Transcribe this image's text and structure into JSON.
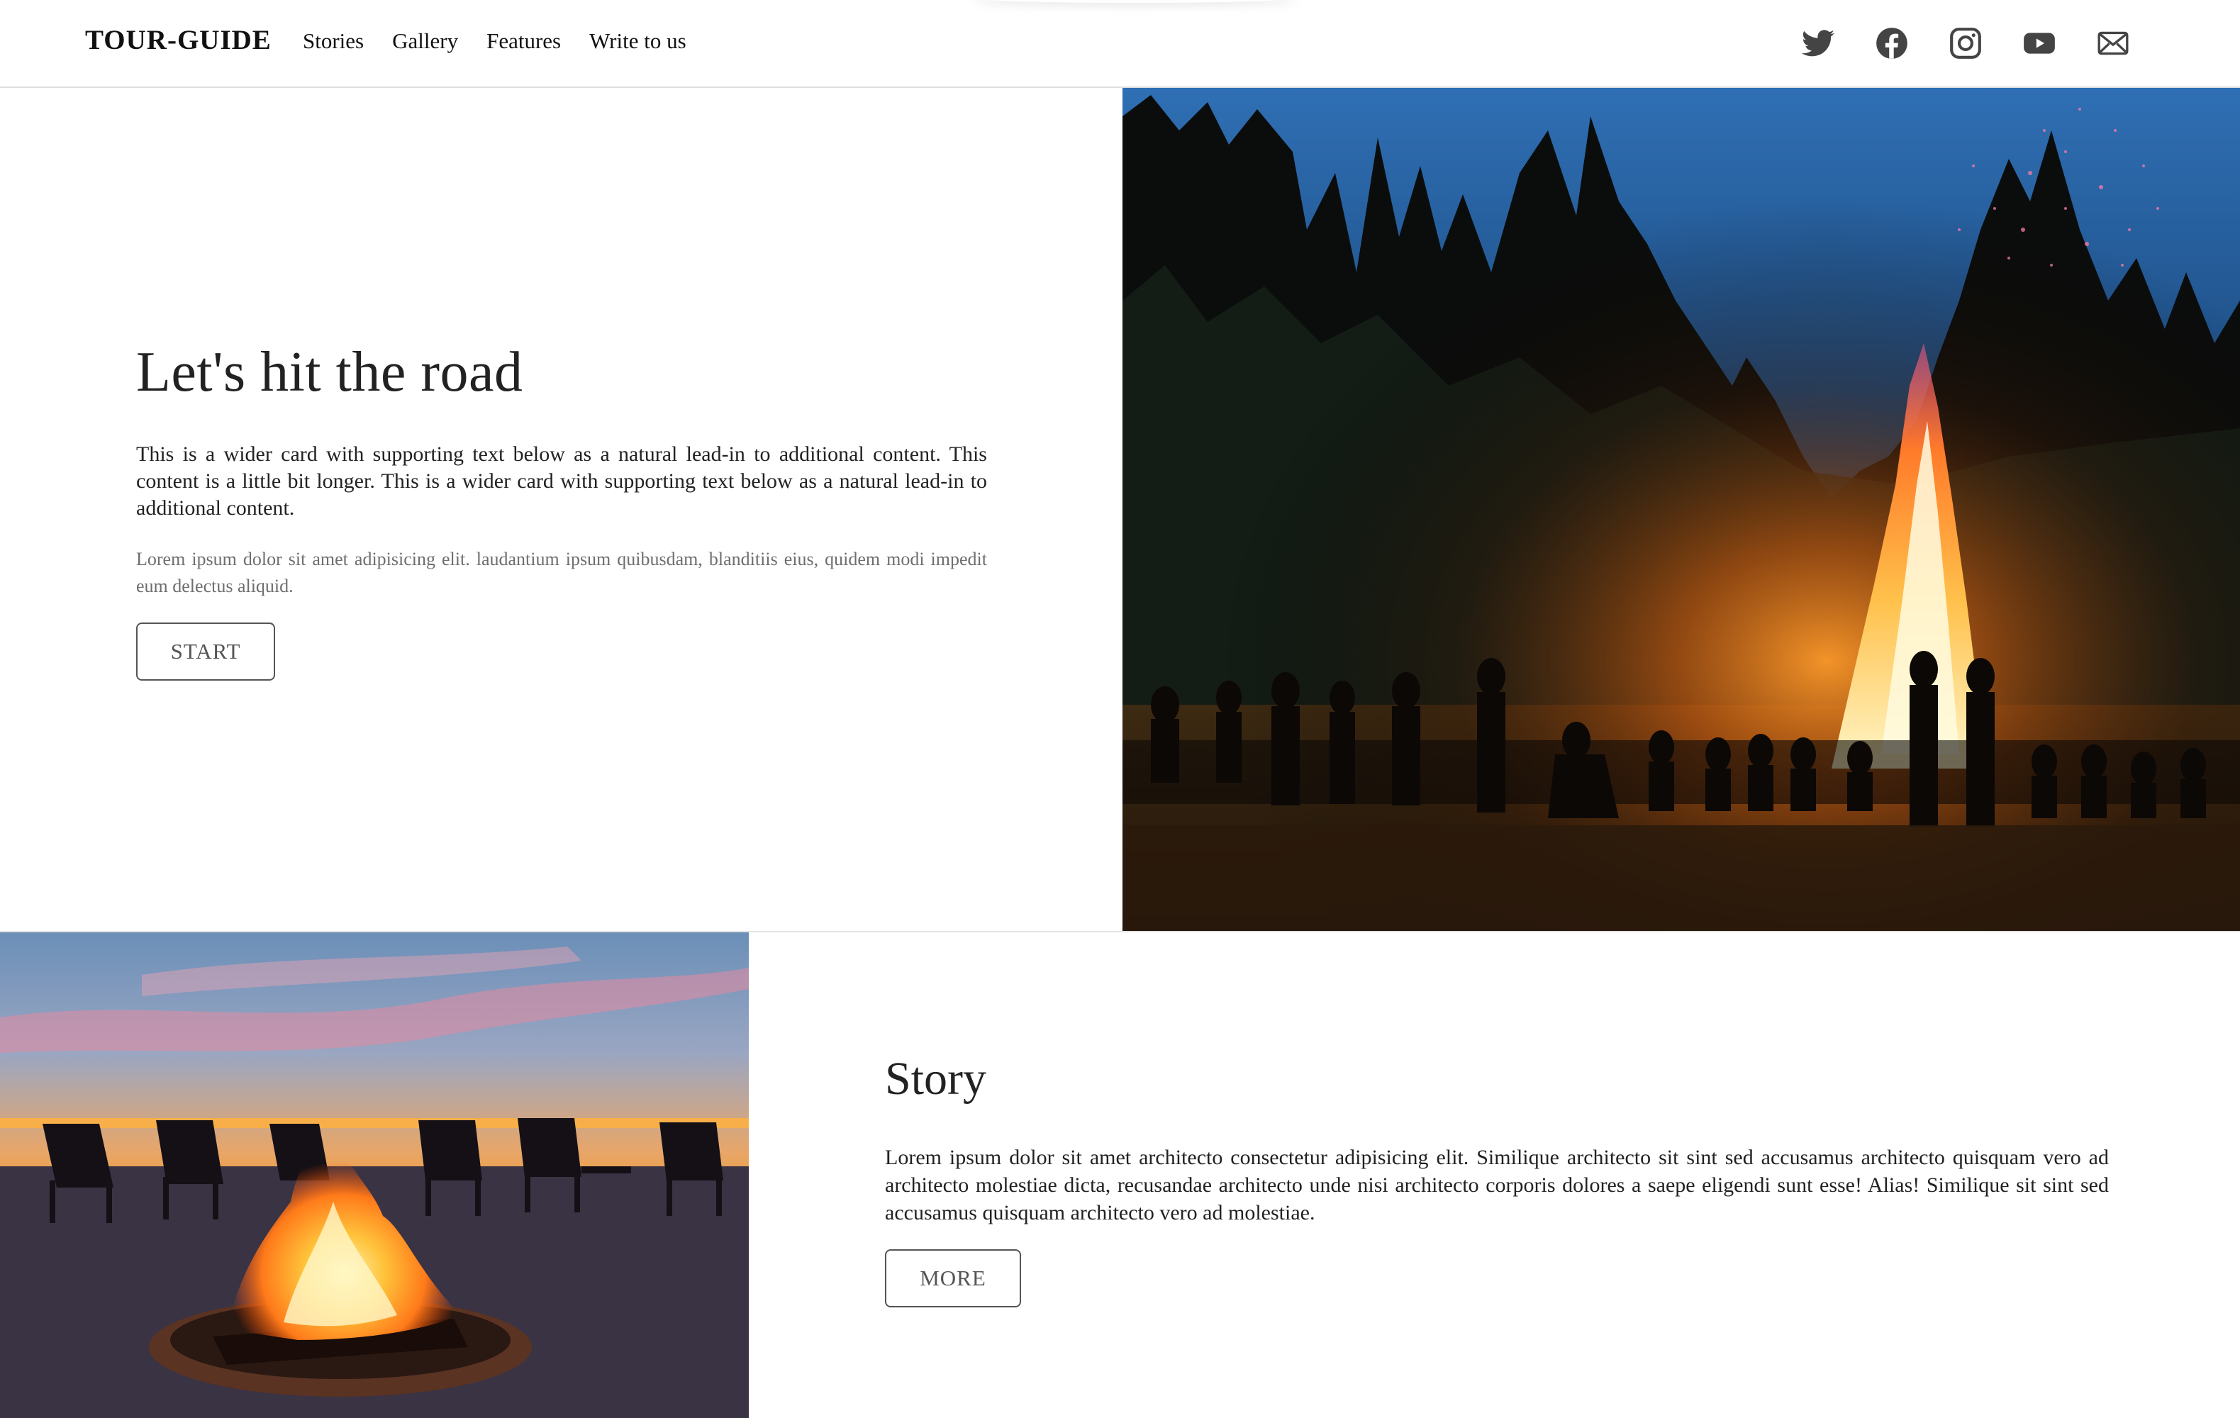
{
  "brand": "TOUR-GUIDE",
  "nav": [
    {
      "label": "Stories"
    },
    {
      "label": "Gallery"
    },
    {
      "label": "Features"
    },
    {
      "label": "Write to us"
    }
  ],
  "social": [
    "twitter-icon",
    "facebook-icon",
    "instagram-icon",
    "youtube-icon",
    "mail-icon"
  ],
  "hero": {
    "title": "Let's hit the road",
    "lead": "This is a wider card with supporting text below as a natural lead-in to additional content. This content is a little bit longer. This is a wider card with supporting text below as a natural lead-in to additional content.",
    "sub": "Lorem ipsum dolor sit amet adipisicing elit. laudantium ipsum quibusdam, blanditiis eius, quidem modi impedit eum delectus aliquid.",
    "button": "START",
    "image": "bonfire-in-forest-night"
  },
  "story": {
    "title": "Story",
    "text": "Lorem ipsum dolor sit amet architecto consectetur adipisicing elit. Similique architecto sit sint sed accusamus architecto quisquam vero ad architecto molestiae dicta, recusandae architecto unde nisi architecto corporis dolores a saepe eligendi sunt esse! Alias! Similique sit sint sed accusamus quisquam architecto vero ad molestiae.",
    "button": "MORE",
    "image": "fire-pit-on-beach-sunset"
  },
  "colors": {
    "text": "#222222",
    "muted": "#6e6e6e",
    "border": "#555555"
  }
}
